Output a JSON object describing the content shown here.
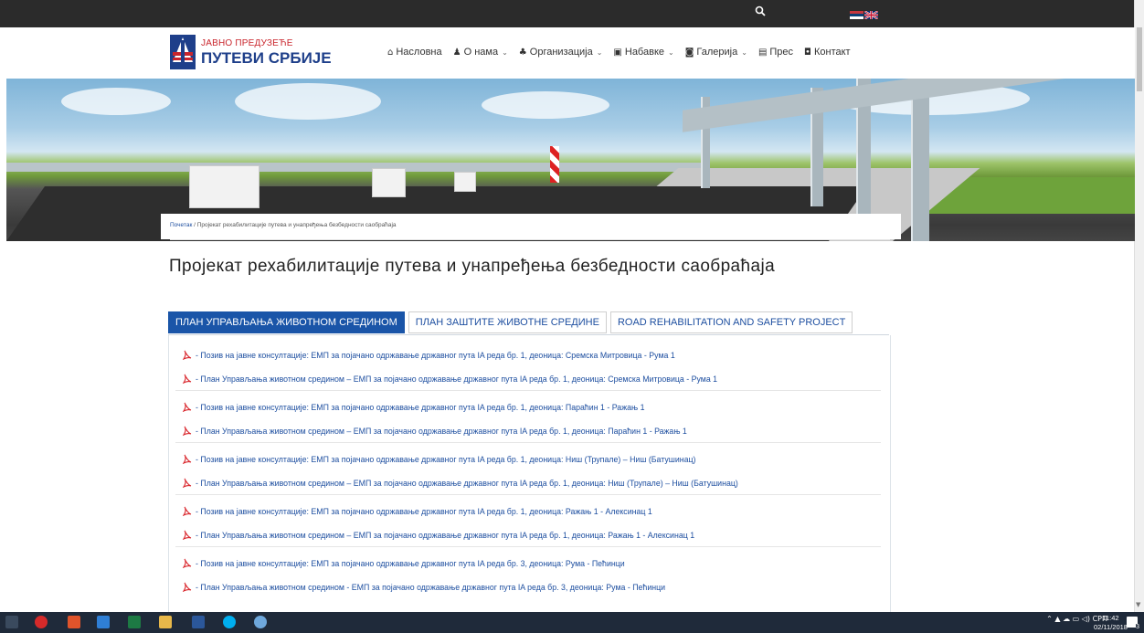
{
  "topbar": {
    "search_icon": "search-icon",
    "languages": [
      "Српски",
      "English"
    ]
  },
  "logo": {
    "line1": "ЈАВНО ПРЕДУЗЕЋЕ",
    "line2": "ПУТЕВИ СРБИЈЕ"
  },
  "nav": [
    {
      "label": "Насловна",
      "icon": "⌂",
      "dropdown": false
    },
    {
      "label": "О нама",
      "icon": "♟",
      "dropdown": true
    },
    {
      "label": "Организација",
      "icon": "♣",
      "dropdown": true
    },
    {
      "label": "Набавке",
      "icon": "▣",
      "dropdown": true
    },
    {
      "label": "Галерија",
      "icon": "◙",
      "dropdown": true
    },
    {
      "label": "Прес",
      "icon": "▤",
      "dropdown": false
    },
    {
      "label": "Контакт",
      "icon": "◘",
      "dropdown": false
    }
  ],
  "breadcrumb": {
    "home": "Почетак",
    "separator": "/",
    "current": "Пројекат рехабилитације путева и унапређења безбедности саобраћаја"
  },
  "page_title": "Пројекат рехабилитације путева и унапређења безбедности саобраћаја",
  "tabs": [
    {
      "label": "ПЛАН УПРАВЉАЊА ЖИВОТНОМ СРЕДИНОМ",
      "active": true
    },
    {
      "label": "ПЛАН ЗАШТИТЕ ЖИВОТНЕ СРЕДИНЕ",
      "active": false
    },
    {
      "label": "ROAD REHABILITATION AND SAFETY PROJECT",
      "active": false
    }
  ],
  "documents": [
    "- Позив на јавне консултације: ЕМП за појачано одржавање државног пута IA реда бр. 1, деоница: Сремска Митровица - Рума 1",
    "- План Управљања животном средином – ЕМП за појачано одржавање државног пута IA реда бр. 1, деоница: Сремска Митровица - Рума 1",
    "- Позив на јавне консултације: ЕМП за појачано одржавање државног пута IA реда бр. 1, деоница: Параћин 1 - Ражањ 1",
    "- План Управљања животном средином – ЕМП за појачано одржавање државног пута IA реда бр. 1, деоница: Параћин 1 - Ражањ 1",
    "- Позив на јавне консултације: ЕМП за појачано одржавање државног пута IA реда бр. 1, деоница: Ниш (Трупале) – Ниш (Батушинац)",
    "- План Управљања животном средином – ЕМП за појачано одржавање државног пута IA реда бр. 1, деоница: Ниш (Трупале) – Ниш (Батушинац)",
    "- Позив на јавне консултације: ЕМП за појачано одржавање државног пута IA реда бр. 1, деоница: Ражањ 1 - Алексинац 1",
    "- План Управљања животном средином – ЕМП за појачано одржавање државног пута IA реда бр. 1, деоница: Ражањ 1 - Алексинац 1",
    "- Позив на јавне консултације: ЕМП за појачано одржавање државног пута IA реда бр. 3, деоница: Рума - Пећинци",
    "- План Управљања животном средином - ЕМП за појачано одржавање државног пута IA реда бр. 3, деоница: Рума - Пећинци"
  ],
  "taskbar": {
    "tray_lang": "СРП",
    "time": "11:42",
    "date": "02/11/2018",
    "notification_count": "3"
  },
  "colors": {
    "brand_blue": "#1a55a8",
    "link": "#1e4fa0",
    "topbar": "#2b2b2b",
    "taskbar": "#1f2a3a",
    "pdf_red": "#d9252b"
  }
}
